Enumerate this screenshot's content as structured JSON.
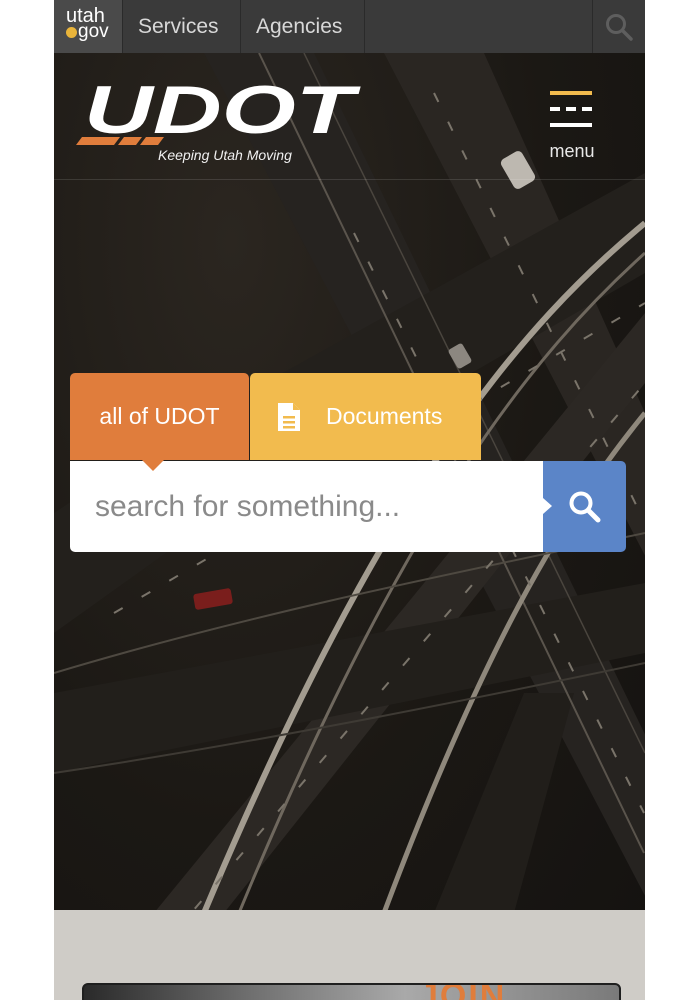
{
  "topbar": {
    "logo_line1": "utah",
    "logo_line2": "gov",
    "services_label": "Services",
    "agencies_label": "Agencies",
    "search_icon": "search-icon"
  },
  "header": {
    "logo_text": "UDOT",
    "tagline": "Keeping Utah Moving",
    "menu_label": "menu"
  },
  "search": {
    "tab_all_label": "all of UDOT",
    "tab_documents_label": "Documents",
    "documents_icon": "document-icon",
    "placeholder": "search for something...",
    "button_icon": "search-icon"
  },
  "promo": {
    "join_text": "JOIN"
  },
  "colors": {
    "orange": "#e07d3c",
    "yellow": "#f2bb4e",
    "blue": "#5b85c8",
    "topbar": "#3a3a3a"
  }
}
